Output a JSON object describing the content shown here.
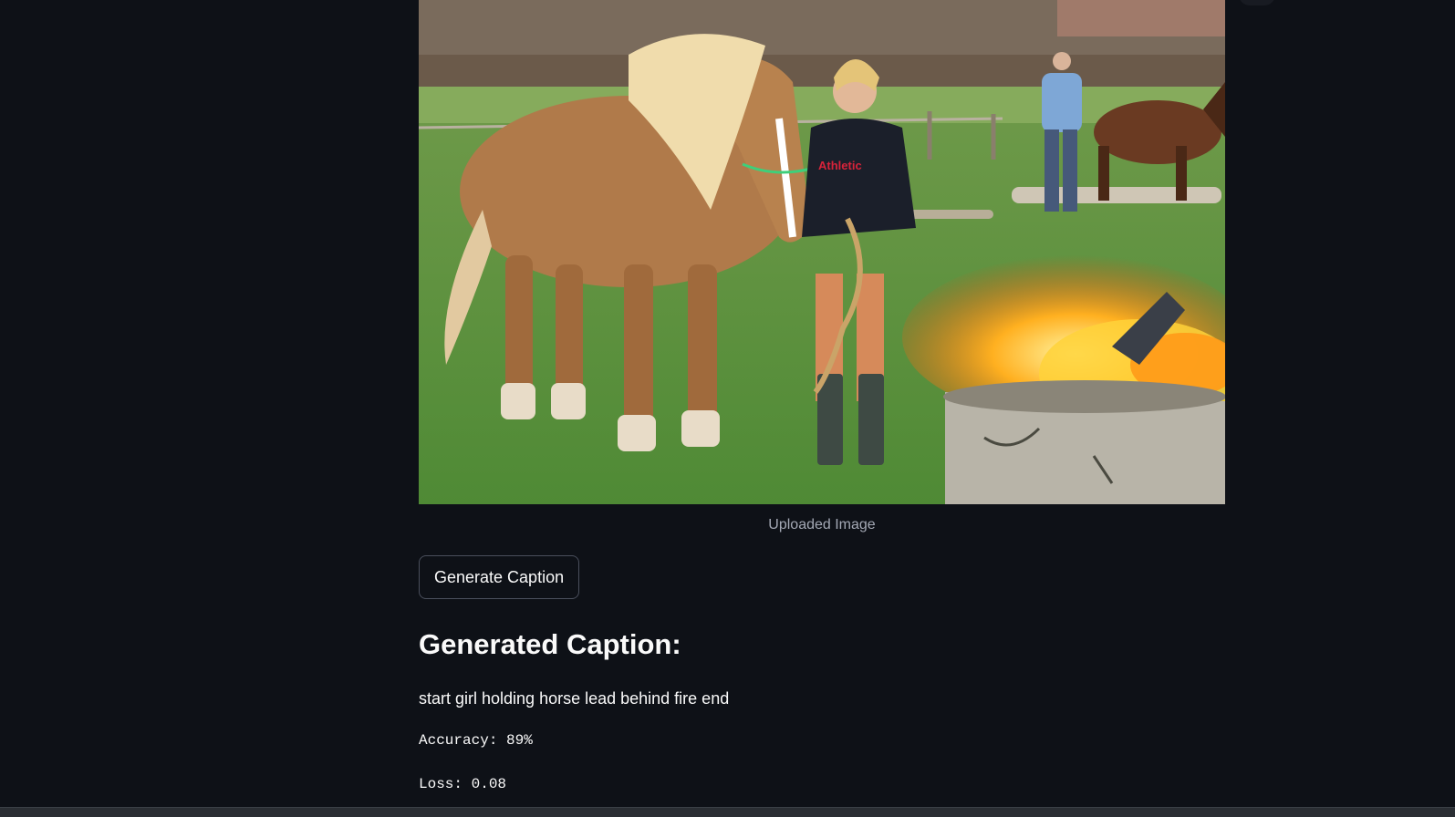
{
  "image": {
    "alt": "Uploaded Image",
    "caption": "Uploaded Image",
    "sweater_text": "Athletic"
  },
  "actions": {
    "generate_label": "Generate Caption"
  },
  "result": {
    "heading": "Generated Caption:",
    "caption_text": "start girl holding horse lead behind fire end",
    "accuracy": "Accuracy: 89%",
    "loss": "Loss: 0.08"
  },
  "colors": {
    "background": "#0e1117",
    "text": "#fafafa",
    "muted_text": "#a3a8b4",
    "button_border": "#4a4f5c"
  }
}
